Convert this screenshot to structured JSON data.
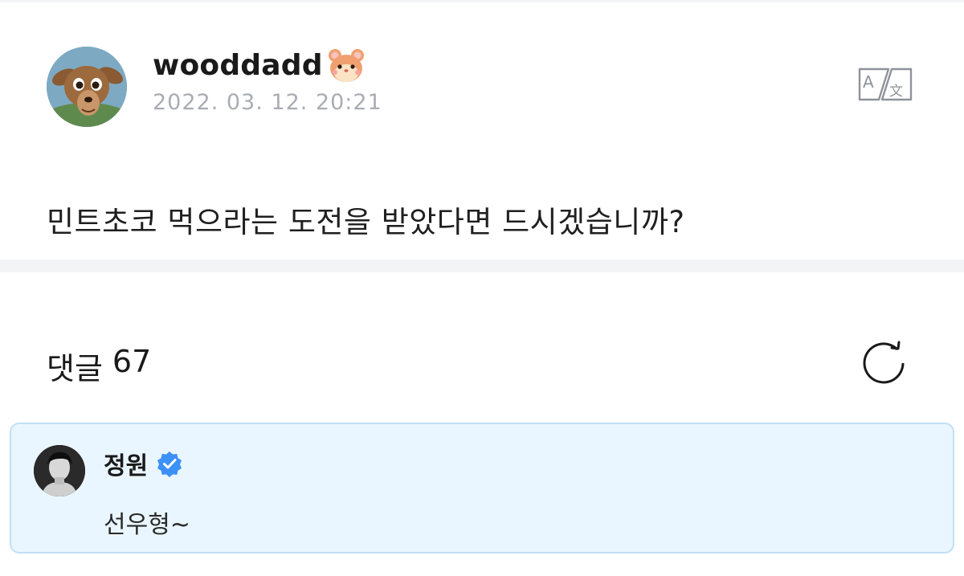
{
  "post": {
    "author": "wooddadd",
    "author_emoji_icon": "hamster-face-icon",
    "date": "2022. 03. 12. 20:21",
    "body": "민트초코 먹으라는 도전을 받았다면 드시겠습니까?",
    "translate_icon": "translate-icon"
  },
  "comments": {
    "label": "댓글",
    "count": "67",
    "refresh_icon": "refresh-icon",
    "items": [
      {
        "author": "정원",
        "verified": true,
        "text": "선우형~"
      }
    ]
  },
  "colors": {
    "date_gray": "#a9adb3",
    "divider": "#f3f4f6",
    "highlight_bg": "#eaf6ff",
    "highlight_border": "#bfe0f5",
    "verified_blue": "#3b91f7"
  }
}
